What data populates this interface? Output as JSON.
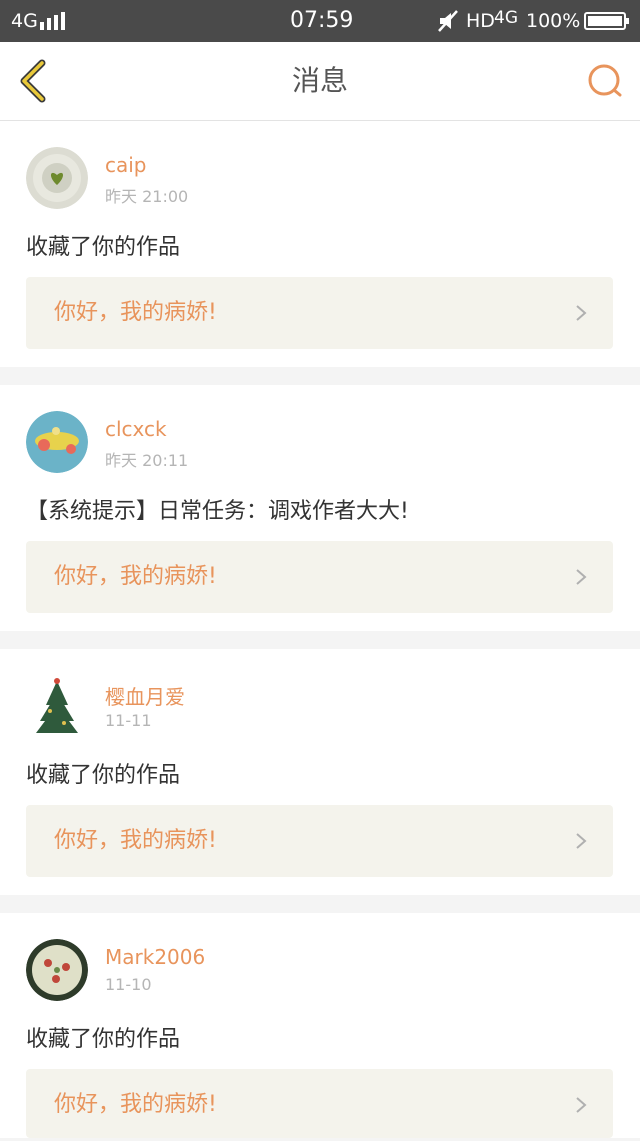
{
  "status_bar": {
    "network": "4G",
    "time": "07:59",
    "hd": "HD",
    "network2": "4G",
    "battery": "100%"
  },
  "header": {
    "title": "消息"
  },
  "messages": [
    {
      "username": "caip",
      "time": "昨天 21:00",
      "content": "收藏了你的作品",
      "work_title": "你好，我的病娇!"
    },
    {
      "username": "clcxck",
      "time": "昨天 20:11",
      "content": "【系统提示】日常任务：调戏作者大大!",
      "work_title": "你好，我的病娇!"
    },
    {
      "username": "樱血月爱",
      "time": "11-11",
      "content": "收藏了你的作品",
      "work_title": "你好，我的病娇!"
    },
    {
      "username": "Mark2006",
      "time": "11-10",
      "content": "收藏了你的作品",
      "work_title": "你好，我的病娇!"
    }
  ],
  "colors": {
    "accent": "#e8945c",
    "back_arrow": "#e9c93a",
    "status_bar": "#4a4a4a"
  }
}
